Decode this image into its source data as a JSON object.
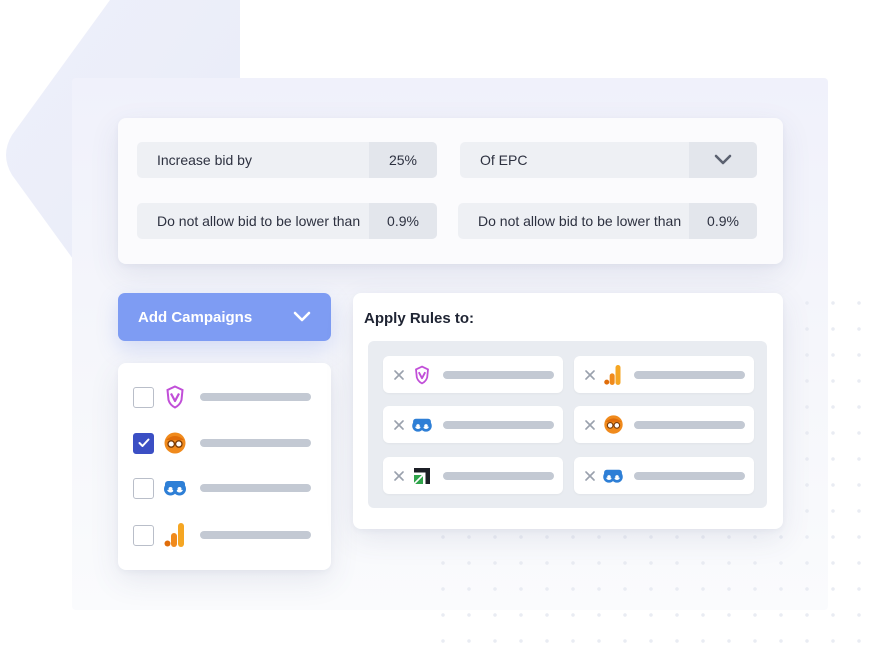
{
  "rules": {
    "row1": {
      "left_label": "Increase bid by",
      "left_value": "25%",
      "right_label": "Of EPC",
      "right_dropdown_icon": "chevron-down-icon"
    },
    "row2": {
      "left_label": "Do not allow bid to be lower than",
      "left_value": "0.9%",
      "right_label": "Do not allow bid to be lower than",
      "right_value": "0.9%"
    }
  },
  "add_campaigns": {
    "label": "Add Campaigns",
    "icon": "chevron-down-icon"
  },
  "campaign_list": [
    {
      "logo": "shield-v-logo-icon",
      "checked": false
    },
    {
      "logo": "glasses-face-logo-icon",
      "checked": true
    },
    {
      "logo": "double-ring-logo-icon",
      "checked": false
    },
    {
      "logo": "bar-chart-logo-icon",
      "checked": false
    }
  ],
  "apply_rules": {
    "title": "Apply Rules to:",
    "chips": [
      {
        "logo": "shield-v-logo-icon"
      },
      {
        "logo": "bar-chart-logo-icon"
      },
      {
        "logo": "double-ring-logo-icon"
      },
      {
        "logo": "glasses-face-logo-icon"
      },
      {
        "logo": "square-arrow-logo-icon"
      },
      {
        "logo": "double-ring-logo-icon"
      }
    ]
  },
  "colors": {
    "accent": "#7e9cf3",
    "checkbox_checked": "#3b4fc4",
    "shield_logo": "#c14fd8",
    "glasses_logo": "#f08a1c",
    "ring_logo": "#2e7fd6",
    "bar_logo": "#f5a623"
  }
}
